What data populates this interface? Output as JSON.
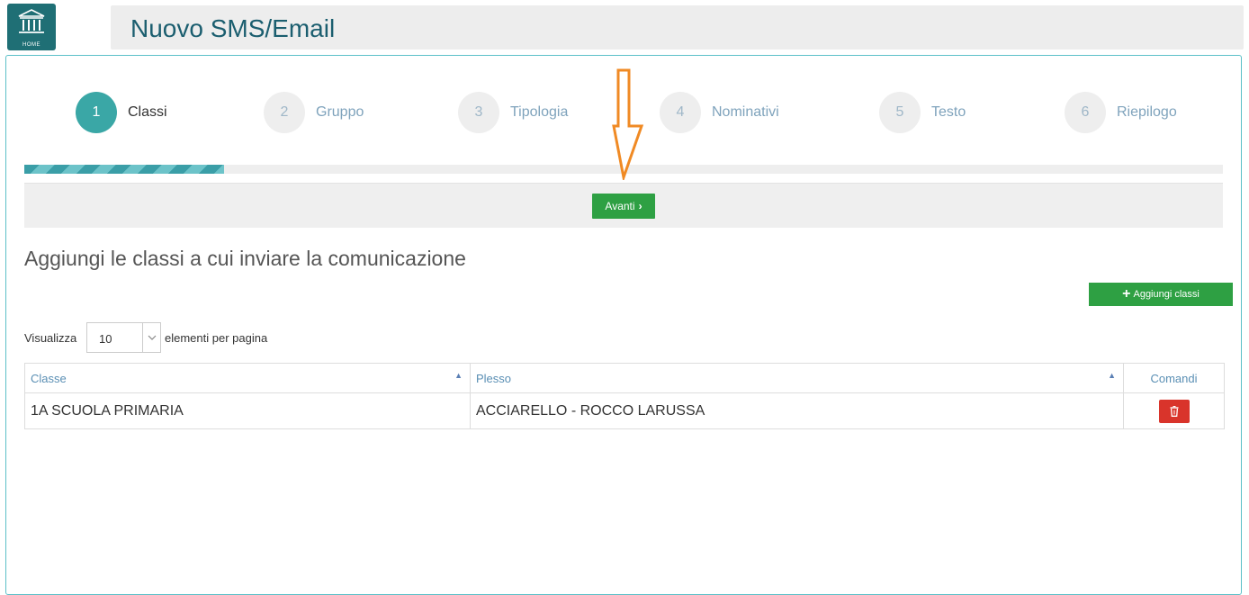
{
  "app": {
    "home_label": "HOME",
    "title": "Nuovo SMS/Email"
  },
  "wizard": {
    "steps": [
      {
        "number": "1",
        "label": "Classi",
        "active": true
      },
      {
        "number": "2",
        "label": "Gruppo",
        "active": false
      },
      {
        "number": "3",
        "label": "Tipologia",
        "active": false
      },
      {
        "number": "4",
        "label": "Nominativi",
        "active": false
      },
      {
        "number": "5",
        "label": "Testo",
        "active": false
      },
      {
        "number": "6",
        "label": "Riepilogo",
        "active": false
      }
    ],
    "progress_fraction": 0.167,
    "next_button_label": "Avanti"
  },
  "section": {
    "heading": "Aggiungi le classi a cui inviare la comunicazione",
    "add_button_label": "Aggiungi classi"
  },
  "pagination": {
    "show_label": "Visualizza",
    "page_size": "10",
    "per_page_label": "elementi per pagina"
  },
  "table": {
    "columns": [
      "Classe",
      "Plesso",
      "Comandi"
    ],
    "rows": [
      {
        "classe": "1A SCUOLA PRIMARIA",
        "plesso": "ACCIARELLO - ROCCO LARUSSA"
      }
    ]
  },
  "colors": {
    "accent_teal": "#3aa7a6",
    "primary_green": "#2ea043",
    "danger_red": "#d9342b",
    "annotation_orange": "#f08a24"
  },
  "icons": {
    "home": "bank-building-icon",
    "next": "chevron-right-icon",
    "add": "plus-icon",
    "select": "chevron-down-icon",
    "sort": "sort-up-icon",
    "delete": "trash-icon",
    "annotation": "down-arrow-icon"
  }
}
